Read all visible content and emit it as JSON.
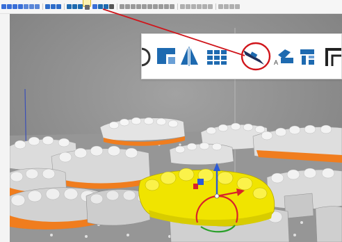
{
  "screen": {
    "description_free": true
  },
  "toolbar": {
    "icons": [
      {
        "name": "view-front-icon",
        "color": "#3a6fd8"
      },
      {
        "name": "view-back-icon",
        "color": "#3a6fd8"
      },
      {
        "name": "view-left-icon",
        "color": "#3a6fd8"
      },
      {
        "name": "view-right-icon",
        "color": "#3a6fd8"
      },
      {
        "name": "view-top-icon",
        "color": "#5a86d8"
      },
      {
        "name": "view-bottom-icon",
        "color": "#5a86d8"
      },
      {
        "name": "view-iso-icon",
        "color": "#5a86d8"
      },
      {
        "name": "move-icon",
        "color": "#2e6cc9"
      },
      {
        "name": "add-icon",
        "color": "#2e6cc9"
      },
      {
        "name": "rotate-icon",
        "color": "#2e6cc9"
      },
      {
        "name": "lay-flat-icon",
        "color": "#1e6ab0"
      },
      {
        "name": "mirror-icon",
        "color": "#1e6ab0"
      },
      {
        "name": "arrange-icon",
        "color": "#1e6ab0"
      }
    ],
    "highlighted": {
      "name": "cut-tool-icon",
      "color": "#6a6a6a"
    },
    "icons_after": [
      {
        "name": "label-icon",
        "color": "#3a6fd8"
      },
      {
        "name": "hollow-icon",
        "color": "#1e6ab0"
      },
      {
        "name": "supports-icon",
        "color": "#1e6ab0"
      },
      {
        "name": "auto-support-icon",
        "color": "#555555"
      },
      {
        "name": "slice-icon",
        "color": "#9a9a9a"
      },
      {
        "name": "settings-icon",
        "color": "#9a9a9a"
      },
      {
        "name": "sphere-icon",
        "color": "#9a9a9a"
      },
      {
        "name": "sphere-2-icon",
        "color": "#9a9a9a"
      },
      {
        "name": "sphere-3-icon",
        "color": "#9a9a9a"
      },
      {
        "name": "circle-icon",
        "color": "#9a9a9a"
      },
      {
        "name": "circle-2-icon",
        "color": "#9a9a9a"
      },
      {
        "name": "circle-3-icon",
        "color": "#9a9a9a"
      },
      {
        "name": "play-icon",
        "color": "#9a9a9a"
      },
      {
        "name": "step-icon",
        "color": "#9a9a9a"
      },
      {
        "name": "grid-icon",
        "color": "#b0b0b0"
      },
      {
        "name": "grid-2-icon",
        "color": "#b0b0b0"
      },
      {
        "name": "grid-3-icon",
        "color": "#b0b0b0"
      },
      {
        "name": "grid-4-icon",
        "color": "#b0b0b0"
      },
      {
        "name": "grid-5-icon",
        "color": "#b0b0b0"
      },
      {
        "name": "print-icon",
        "color": "#b0b0b0"
      },
      {
        "name": "send-icon",
        "color": "#b0b0b0"
      },
      {
        "name": "info-icon",
        "color": "#b0b0b0"
      },
      {
        "name": "help-icon",
        "color": "#b0b0b0"
      },
      {
        "name": "more-icon",
        "color": "#b0b0b0"
      }
    ]
  },
  "callout": {
    "icons": [
      {
        "name": "rotate-partial-icon"
      },
      {
        "name": "lay-flat-icon"
      },
      {
        "name": "mirror-icon"
      },
      {
        "name": "arrange-grid-icon"
      },
      {
        "name": "cut-tool-icon",
        "circled": true
      },
      {
        "name": "label-icon"
      },
      {
        "name": "supports-icon"
      },
      {
        "name": "frame-partial-icon"
      }
    ]
  },
  "colors": {
    "accent": "#d0151b",
    "model": "#e6e6e6",
    "model_shadow": "#a9a9a9",
    "model_base": "#f07d1e",
    "selected": "#f2e600",
    "platform": "#8d8d8d",
    "axis_x": "#d8232a",
    "axis_y": "#2aa02a",
    "axis_z": "#2a5ad8"
  }
}
